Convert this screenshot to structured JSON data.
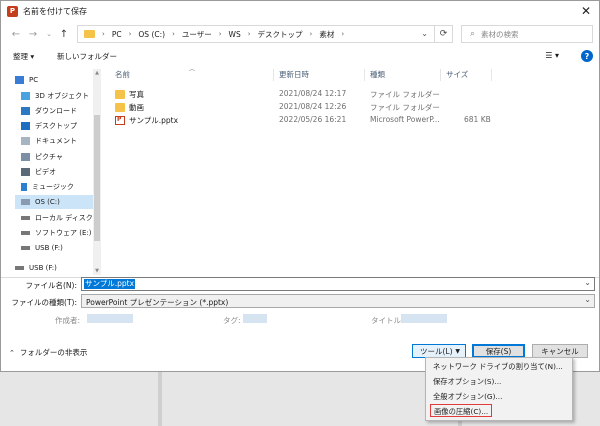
{
  "window": {
    "title": "名前を付けて保存",
    "app_icon": "powerpoint-icon"
  },
  "address_bar": {
    "breadcrumbs": [
      "PC",
      "OS (C:)",
      "ユーザー",
      "WS",
      "デスクトップ",
      "素材"
    ],
    "search_placeholder": "素材の検索"
  },
  "toolbar": {
    "organize": "整理 ▾",
    "new_folder": "新しいフォルダー"
  },
  "sidebar": {
    "items": [
      {
        "label": "PC",
        "icon": "pc-icon"
      },
      {
        "label": "3D オブジェクト",
        "icon": "3d-objects-icon"
      },
      {
        "label": "ダウンロード",
        "icon": "download-icon"
      },
      {
        "label": "デスクトップ",
        "icon": "desktop-icon"
      },
      {
        "label": "ドキュメント",
        "icon": "documents-icon"
      },
      {
        "label": "ピクチャ",
        "icon": "pictures-icon"
      },
      {
        "label": "ビデオ",
        "icon": "videos-icon"
      },
      {
        "label": "ミュージック",
        "icon": "music-icon"
      },
      {
        "label": "OS (C:)",
        "icon": "drive-icon",
        "selected": true
      },
      {
        "label": "ローカル ディスク (D",
        "icon": "drive-icon"
      },
      {
        "label": "ソフトウェア (E:)",
        "icon": "drive-icon"
      },
      {
        "label": "USB (F:)",
        "icon": "usb-drive-icon"
      },
      {
        "label": "USB (F:)",
        "icon": "usb-drive-icon"
      }
    ]
  },
  "filelist": {
    "columns": [
      "名前",
      "更新日時",
      "種類",
      "サイズ"
    ],
    "rows": [
      {
        "name": "写真",
        "modified": "2021/08/24 12:17",
        "type": "ファイル フォルダー",
        "size": "",
        "icon": "folder-icon"
      },
      {
        "name": "動画",
        "modified": "2021/08/24 12:26",
        "type": "ファイル フォルダー",
        "size": "",
        "icon": "folder-icon"
      },
      {
        "name": "サンプル.pptx",
        "modified": "2022/05/26 16:21",
        "type": "Microsoft PowerP...",
        "size": "681 KB",
        "icon": "pptx-file-icon"
      }
    ]
  },
  "form": {
    "filename_label": "ファイル名(N):",
    "filename_value": "サンプル.pptx",
    "filetype_label": "ファイルの種類(T):",
    "filetype_value": "PowerPoint プレゼンテーション (*.pptx)",
    "author_label": "作成者:",
    "tags_label": "タグ:",
    "title_label": "タイトル:"
  },
  "footer": {
    "hide_folders": "フォルダーの非表示",
    "tools": "ツール(L)",
    "save": "保存(S)",
    "cancel": "キャンセル"
  },
  "tools_menu": {
    "items": [
      "ネットワーク ドライブの割り当て(N)...",
      "保存オプション(S)...",
      "全般オプション(G)...",
      "画像の圧縮(C)..."
    ],
    "highlighted_index": 3,
    "highlight_color": "#e23b3b"
  },
  "colors": {
    "accent": "#0078d7",
    "selection": "#cce4f7",
    "folder": "#f5c24a",
    "ppt": "#c43e1c"
  }
}
